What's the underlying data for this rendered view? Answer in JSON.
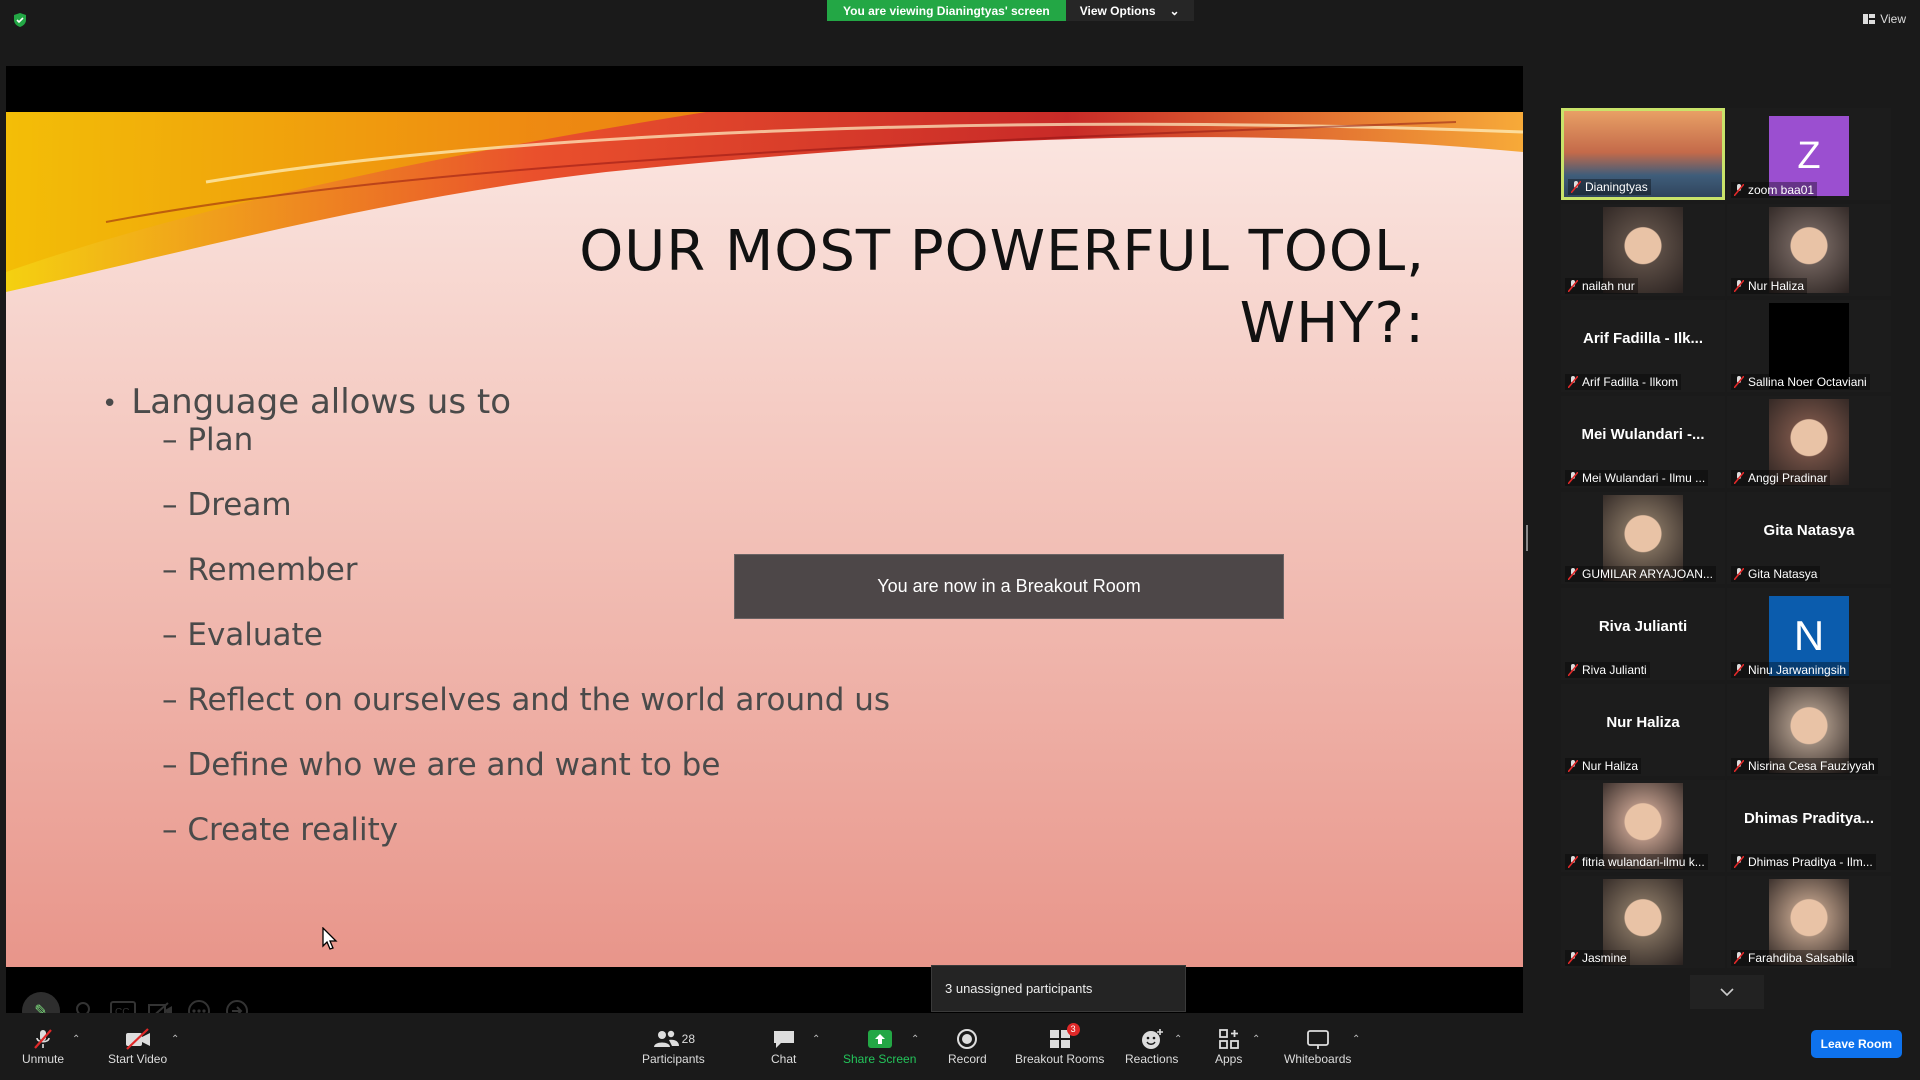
{
  "banner": {
    "viewing_text": "You are viewing Dianingtyas' screen",
    "view_options_label": "View Options"
  },
  "view_label": "View",
  "slide": {
    "title_line1": "OUR MOST POWERFUL TOOL,",
    "title_line2": "WHY?:",
    "bullet_main": "Language allows us to",
    "sub_bullets": [
      "Plan",
      "Dream",
      "Remember",
      "Evaluate",
      "Reflect on ourselves and the world around us",
      "Define who we are and want to be",
      "Create reality"
    ]
  },
  "breakout_toast": "You are now in a Breakout Room",
  "unassigned_tooltip": "3 unassigned participants",
  "participants": [
    {
      "label": "Dianingtyas",
      "kind": "video"
    },
    {
      "label": "zoom baa01",
      "kind": "avatar",
      "letter": "Z"
    },
    {
      "label": "nailah nur",
      "kind": "video"
    },
    {
      "label": "Nur Haliza",
      "kind": "video"
    },
    {
      "label": "Arif Fadilla - Ilkom",
      "kind": "name",
      "big": "Arif Fadilla - Ilk..."
    },
    {
      "label": "Sallina Noer Octaviani",
      "kind": "black"
    },
    {
      "label": "Mei Wulandari - Ilmu ...",
      "kind": "name",
      "big": "Mei Wulandari -..."
    },
    {
      "label": "Anggi Pradinar",
      "kind": "video"
    },
    {
      "label": "GUMILAR ARYAJOAN...",
      "kind": "video"
    },
    {
      "label": "Gita Natasya",
      "kind": "name",
      "big": "Gita Natasya"
    },
    {
      "label": "Riva Julianti",
      "kind": "name",
      "big": "Riva Julianti"
    },
    {
      "label": "Ninu Jarwaningsih",
      "kind": "avatar",
      "letter": "N"
    },
    {
      "label": "Nur Haliza",
      "kind": "name",
      "big": "Nur Haliza"
    },
    {
      "label": "Nisrina Cesa Fauziyyah",
      "kind": "video"
    },
    {
      "label": "fitria wulandari-ilmu k...",
      "kind": "video"
    },
    {
      "label": "Dhimas Praditya - Ilm...",
      "kind": "name",
      "big": "Dhimas Praditya..."
    },
    {
      "label": "Jasmine",
      "kind": "video"
    },
    {
      "label": "Farahdiba Salsabila",
      "kind": "video"
    }
  ],
  "toolbar": {
    "unmute": "Unmute",
    "start_video": "Start Video",
    "participants": "Participants",
    "participants_count": "28",
    "chat": "Chat",
    "share_screen": "Share Screen",
    "record": "Record",
    "breakout_rooms": "Breakout Rooms",
    "breakout_badge": "3",
    "reactions": "Reactions",
    "apps": "Apps",
    "whiteboards": "Whiteboards",
    "leave": "Leave Room"
  },
  "colors": {
    "share_green": "#23a745",
    "leave_blue": "#0e72ed",
    "active_border": "#c9e36a",
    "mute_red": "#e02828"
  }
}
